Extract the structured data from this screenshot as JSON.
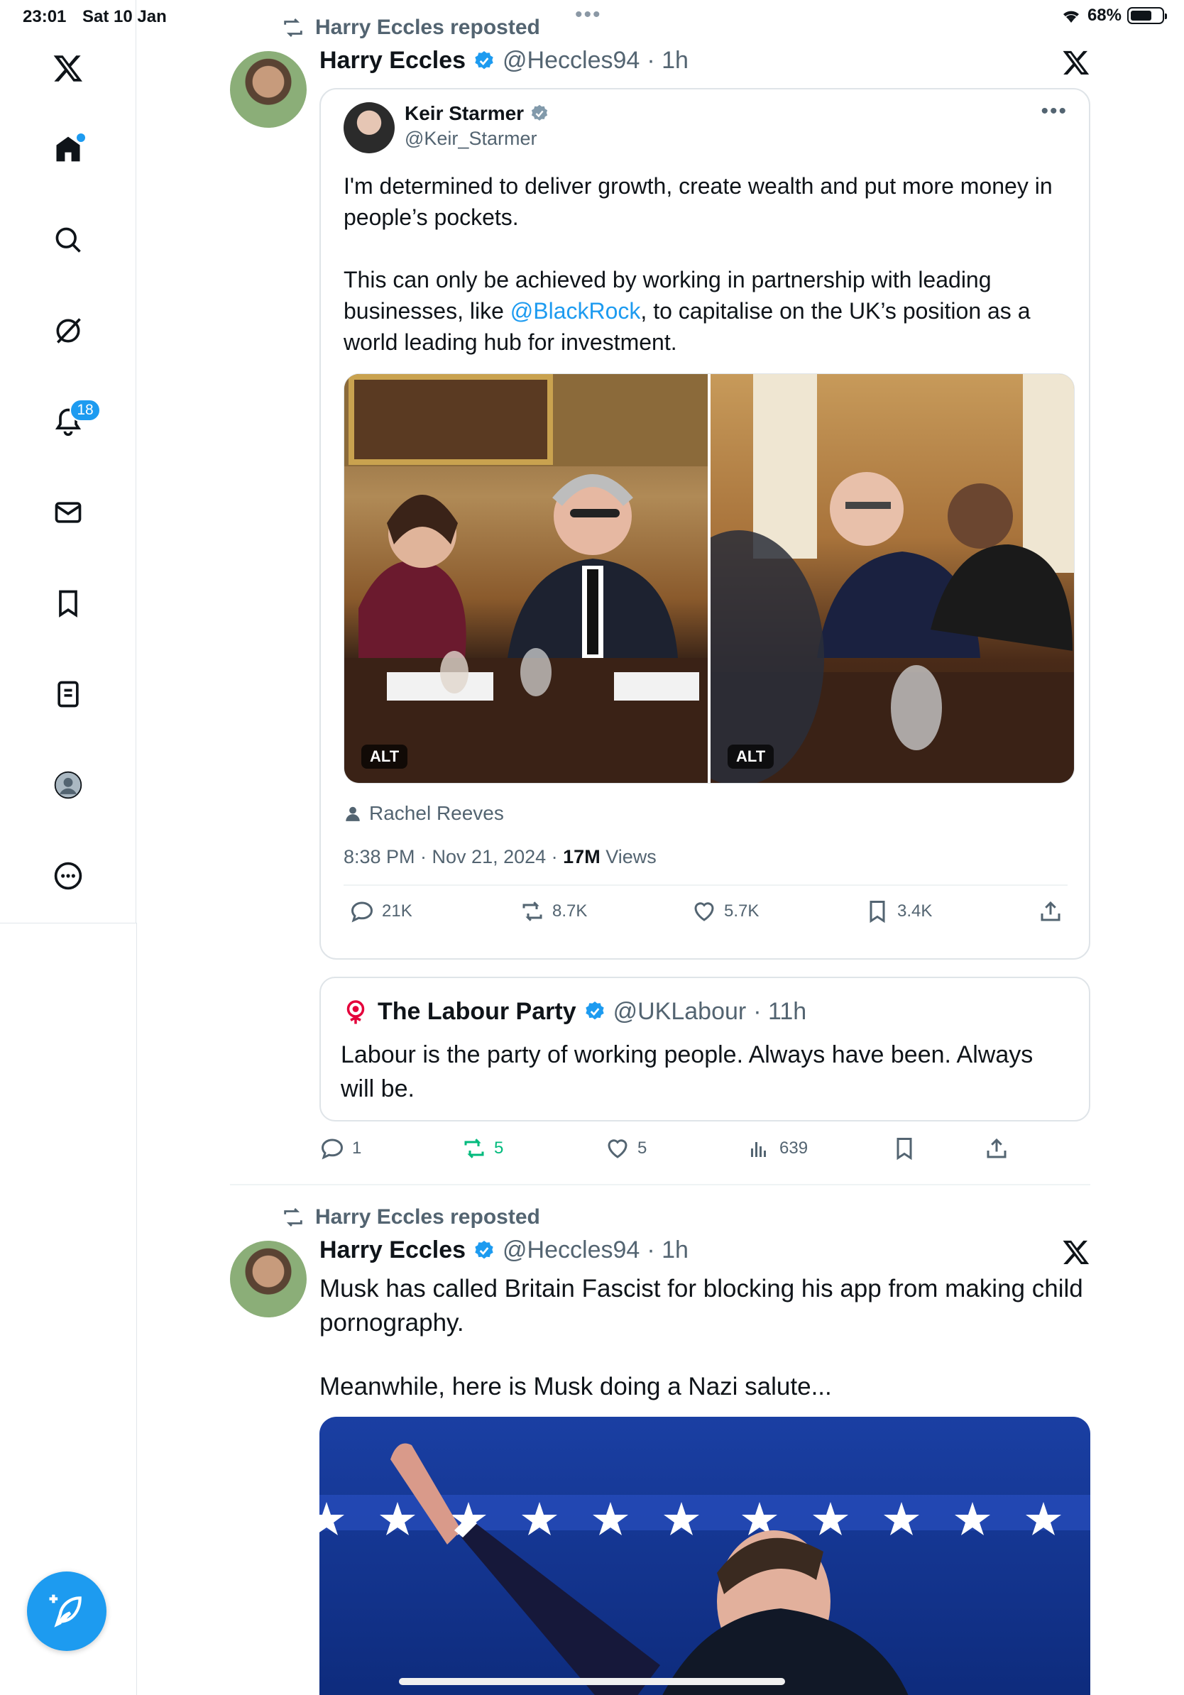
{
  "status_bar": {
    "time": "23:01",
    "date": "Sat 10 Jan",
    "battery": "68%"
  },
  "sidebar": {
    "notifications_badge": "18",
    "items": [
      "home-icon",
      "search-icon",
      "grok-icon",
      "notifications-icon",
      "messages-icon",
      "bookmarks-icon",
      "lists-icon",
      "profile-icon",
      "more-icon"
    ]
  },
  "tweet1": {
    "repost_label": "Harry Eccles reposted",
    "author_name": "Harry Eccles",
    "author_handle": "@Heccles94",
    "time": "· 1h",
    "quoted": {
      "name": "Keir Starmer",
      "handle": "@Keir_Starmer",
      "text_p1": "I'm determined to deliver growth, create wealth and put more money in people’s pockets.",
      "text_p2_a": "This can only be achieved by working in partnership with leading businesses, like ",
      "text_p2_link": "@BlackRock",
      "text_p2_b": ", to capitalise on the UK’s position as a world leading hub for investment.",
      "alt_label": "ALT",
      "tagged": "Rachel Reeves",
      "meta_time": "8:38 PM · Nov 21, 2024 · ",
      "views_count": "17M",
      "views_label": " Views",
      "replies": "21K",
      "reposts": "8.7K",
      "likes": "5.7K",
      "bookmarks": "3.4K"
    },
    "embedded": {
      "name": "The Labour Party",
      "handle": "@UKLabour",
      "time": "· 11h",
      "text": "Labour is the party of working people. Always have been. Always will be."
    },
    "actions": {
      "replies": "1",
      "reposts": "5",
      "likes": "5",
      "views": "639"
    }
  },
  "tweet2": {
    "repost_label": "Harry Eccles reposted",
    "author_name": "Harry Eccles",
    "author_handle": "@Heccles94",
    "time": "· 1h",
    "text_p1": "Musk has called Britain Fascist for blocking his app from making child pornography.",
    "text_p2": "Meanwhile, here is Musk doing a Nazi salute..."
  },
  "colors": {
    "accent": "#1d9bf0",
    "repost_green": "#00ba7c",
    "muted": "#536471"
  }
}
